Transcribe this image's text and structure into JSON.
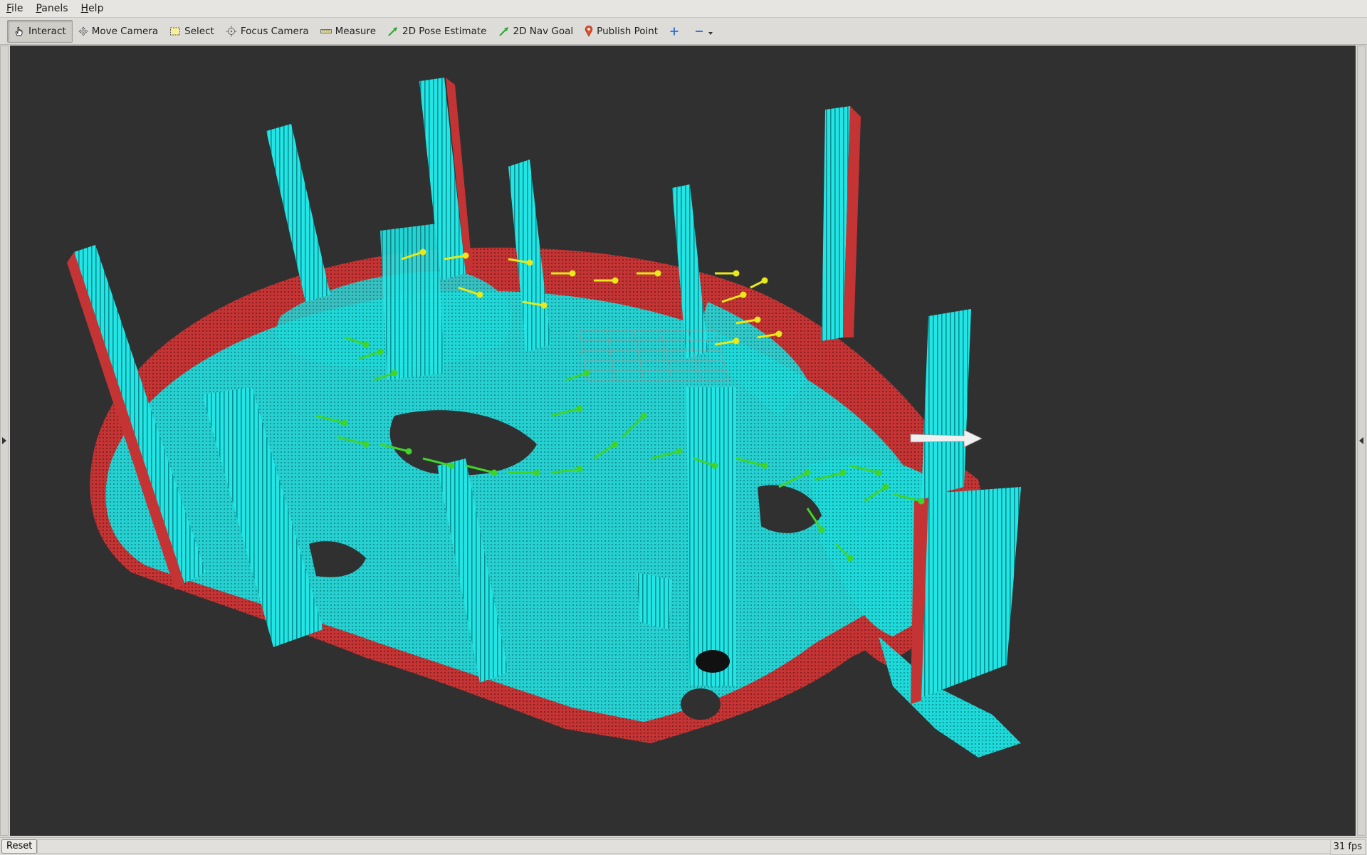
{
  "menu": {
    "file": {
      "mnemonic": "F",
      "rest": "ile"
    },
    "panels": {
      "mnemonic": "P",
      "rest": "anels"
    },
    "help": {
      "mnemonic": "H",
      "rest": "elp"
    }
  },
  "toolbar": {
    "interact": "Interact",
    "move_camera": "Move Camera",
    "select": "Select",
    "focus_camera": "Focus Camera",
    "measure": "Measure",
    "pose_estimate": "2D Pose Estimate",
    "nav_goal": "2D Nav Goal",
    "publish_point": "Publish Point"
  },
  "status": {
    "reset": "Reset",
    "fps": "31 fps"
  },
  "colors": {
    "background": "#303030",
    "map_cyan": "#1fe8e8",
    "map_red": "#d23a3a",
    "grid": "#9a9a9a",
    "pose_arrow_green": "#3fd42a",
    "path_arrow_yellow": "#e8e81a",
    "robot_arrow": "#f0f0f0"
  },
  "icons": [
    "hand-icon",
    "move-camera-icon",
    "select-icon",
    "focus-camera-icon",
    "ruler-icon",
    "pose-arrow-icon",
    "nav-goal-icon",
    "map-pin-icon",
    "plus-icon",
    "minus-icon",
    "chevron-down-icon"
  ]
}
